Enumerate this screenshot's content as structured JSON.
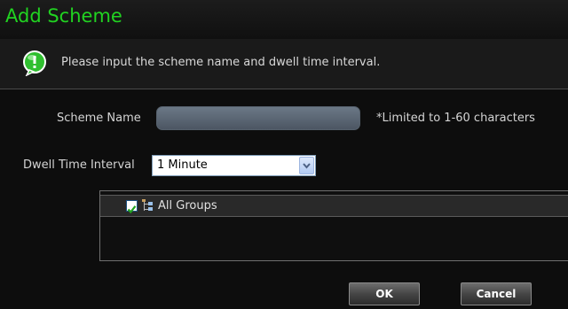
{
  "dialog": {
    "title": "Add Scheme",
    "info_text": "Please input the scheme name and dwell time interval."
  },
  "form": {
    "scheme_name_label": "Scheme Name",
    "scheme_name_value": "",
    "scheme_name_hint": "*Limited to 1-60 characters",
    "dwell_label": "Dwell Time Interval",
    "dwell_value": "1 Minute"
  },
  "tree": {
    "root_label": "All Groups",
    "root_checked": true
  },
  "buttons": {
    "ok_label": "OK",
    "cancel_label": "Cancel"
  },
  "colors": {
    "title_green": "#21d321",
    "background": "#0d0d0d",
    "info_icon_green": "#2fbf2f"
  },
  "icons": {
    "info": "info-speech-bubble-icon",
    "checkbox": "checkmark-icon",
    "group": "group-tree-icon",
    "dropdown": "chevron-down-icon"
  }
}
